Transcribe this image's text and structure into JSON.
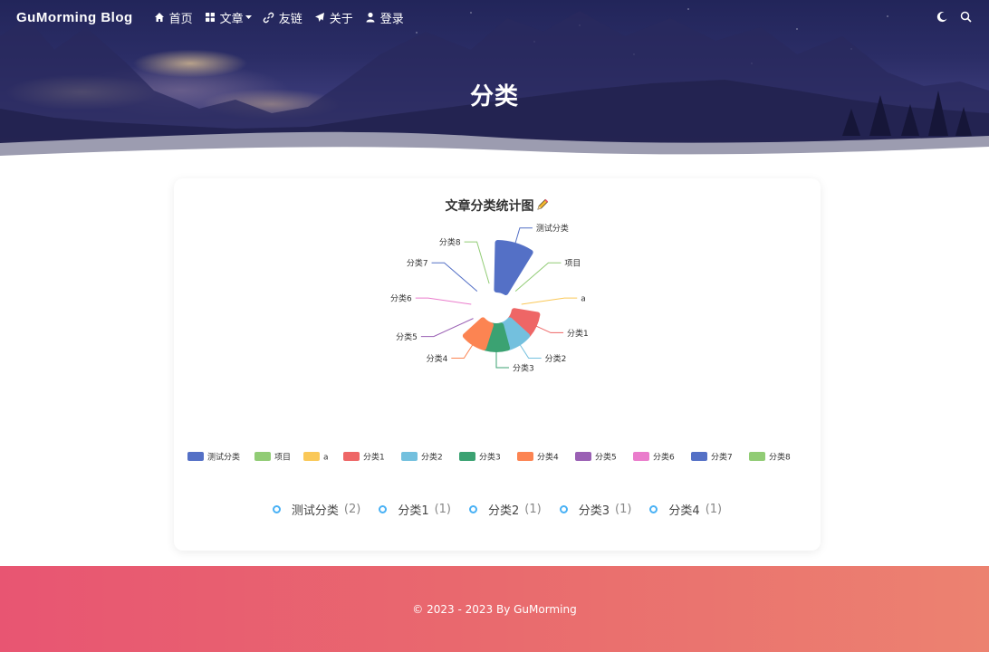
{
  "nav": {
    "brand": "GuMorming Blog",
    "items": [
      {
        "label": "首页",
        "icon": "home-icon"
      },
      {
        "label": "文章",
        "icon": "grid-icon",
        "has_dropdown": true
      },
      {
        "label": "友链",
        "icon": "link-icon"
      },
      {
        "label": "关于",
        "icon": "paper-plane-icon"
      },
      {
        "label": "登录",
        "icon": "user-icon"
      }
    ],
    "right_icons": [
      "dark-mode-icon",
      "search-icon"
    ]
  },
  "hero": {
    "title": "分类"
  },
  "chart_data": {
    "type": "pie",
    "rose": true,
    "title": "文章分类统计图",
    "categories": [
      "测试分类",
      "项目",
      "a",
      "分类1",
      "分类2",
      "分类3",
      "分类4",
      "分类5",
      "分类6",
      "分类7",
      "分类8"
    ],
    "values": [
      2,
      0,
      0,
      1,
      1,
      1,
      1,
      0,
      0,
      0,
      0
    ],
    "colors": [
      "#5470c6",
      "#91cc75",
      "#fac858",
      "#ee6666",
      "#73c0de",
      "#3ba272",
      "#fc8452",
      "#9a60b4",
      "#ea7ccc",
      "#5470c6",
      "#91cc75"
    ],
    "legend_position": "bottom"
  },
  "categories_list": [
    {
      "name": "测试分类",
      "count": "(2)"
    },
    {
      "name": "分类1",
      "count": "(1)"
    },
    {
      "name": "分类2",
      "count": "(1)"
    },
    {
      "name": "分类3",
      "count": "(1)"
    },
    {
      "name": "分类4",
      "count": "(1)"
    }
  ],
  "footer": {
    "text": "© 2023 - 2023 By GuMorming"
  },
  "colors": {
    "accent": "#49b1f5",
    "footer_start": "#e85572",
    "footer_end": "#ec8270"
  }
}
